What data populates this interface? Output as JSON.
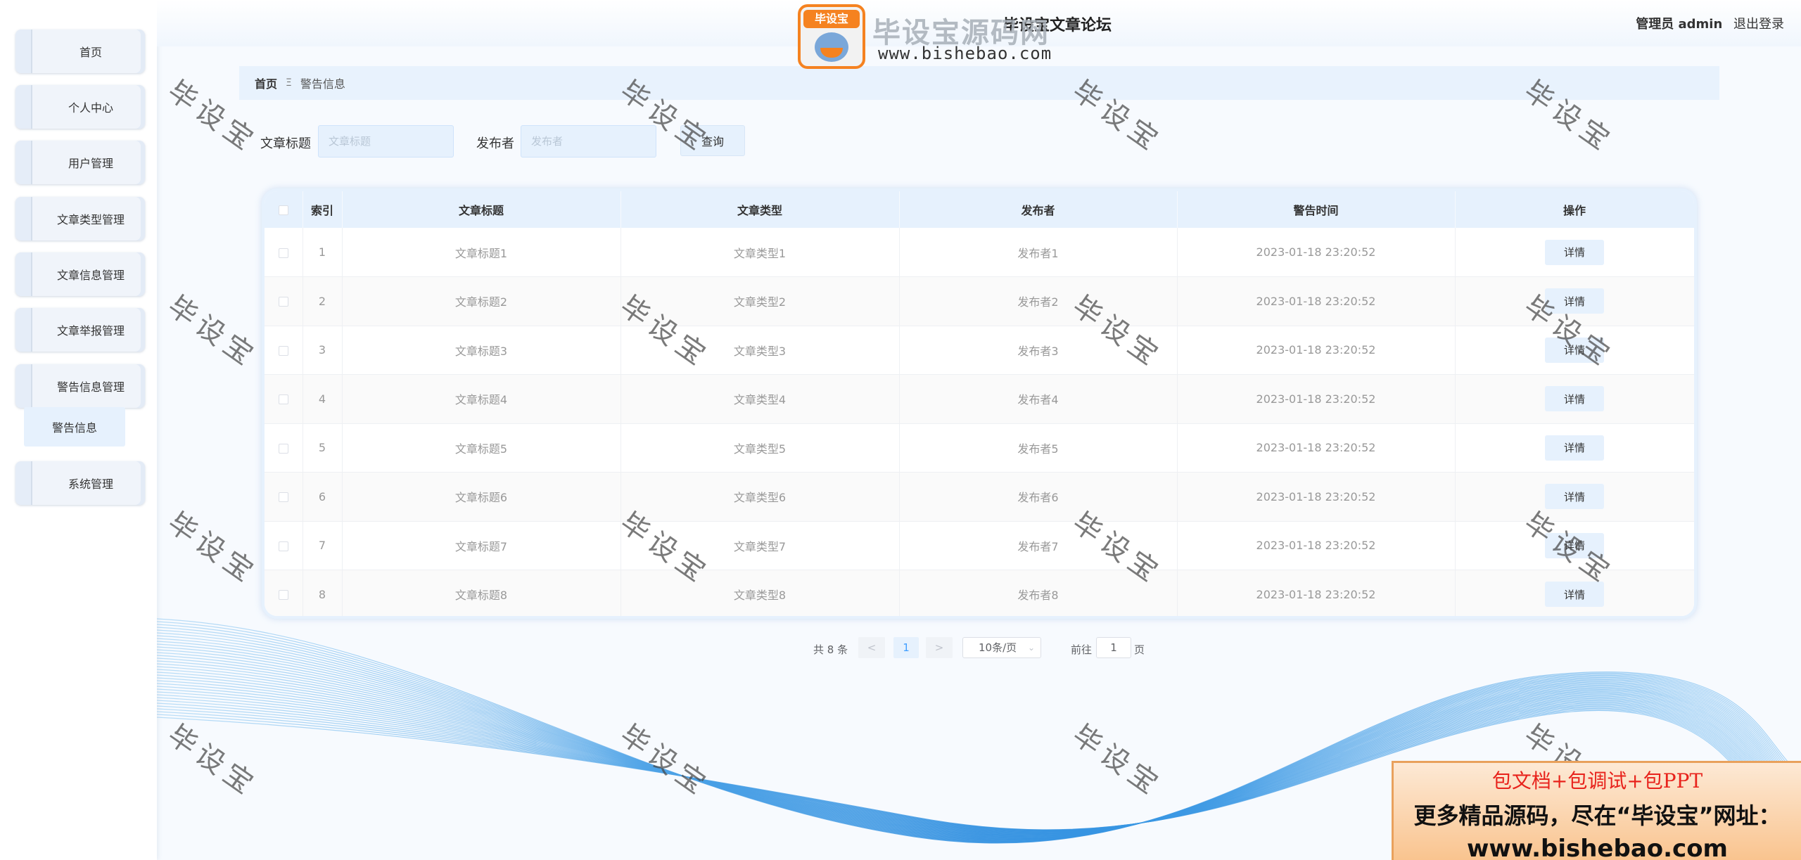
{
  "colors": {
    "accent": "#e6f1fd",
    "link": "#409eff",
    "wave": "#4aa3e8",
    "ad_red": "#e8231c"
  },
  "logo": {
    "badge": "毕设宝",
    "text": "毕设宝源码网",
    "url": "www.bishebao.com"
  },
  "header": {
    "title": "毕设宝文章论坛",
    "user_role": "管理员 admin",
    "logout": "退出登录"
  },
  "sidebar": {
    "items": [
      {
        "label": "首页"
      },
      {
        "label": "个人中心"
      },
      {
        "label": "用户管理"
      },
      {
        "label": "文章类型管理"
      },
      {
        "label": "文章信息管理"
      },
      {
        "label": "文章举报管理"
      },
      {
        "label": "警告信息管理"
      },
      {
        "label": "系统管理"
      }
    ],
    "submenu": {
      "label": "警告信息"
    }
  },
  "breadcrumb": {
    "home": "首页",
    "separator": "Ξ",
    "current": "警告信息"
  },
  "search": {
    "title_label": "文章标题",
    "title_placeholder": "文章标题",
    "author_label": "发布者",
    "author_placeholder": "发布者",
    "query_button": "查询"
  },
  "table": {
    "headers": {
      "index": "索引",
      "title": "文章标题",
      "type": "文章类型",
      "author": "发布者",
      "time": "警告时间",
      "action": "操作"
    },
    "detail_label": "详情",
    "rows": [
      {
        "index": "1",
        "title": "文章标题1",
        "type": "文章类型1",
        "author": "发布者1",
        "time": "2023-01-18 23:20:52"
      },
      {
        "index": "2",
        "title": "文章标题2",
        "type": "文章类型2",
        "author": "发布者2",
        "time": "2023-01-18 23:20:52"
      },
      {
        "index": "3",
        "title": "文章标题3",
        "type": "文章类型3",
        "author": "发布者3",
        "time": "2023-01-18 23:20:52"
      },
      {
        "index": "4",
        "title": "文章标题4",
        "type": "文章类型4",
        "author": "发布者4",
        "time": "2023-01-18 23:20:52"
      },
      {
        "index": "5",
        "title": "文章标题5",
        "type": "文章类型5",
        "author": "发布者5",
        "time": "2023-01-18 23:20:52"
      },
      {
        "index": "6",
        "title": "文章标题6",
        "type": "文章类型6",
        "author": "发布者6",
        "time": "2023-01-18 23:20:52"
      },
      {
        "index": "7",
        "title": "文章标题7",
        "type": "文章类型7",
        "author": "发布者7",
        "time": "2023-01-18 23:20:52"
      },
      {
        "index": "8",
        "title": "文章标题8",
        "type": "文章类型8",
        "author": "发布者8",
        "time": "2023-01-18 23:20:52"
      }
    ]
  },
  "pagination": {
    "total": "共 8 条",
    "prev": "<",
    "current": "1",
    "next": ">",
    "page_size": "10条/页",
    "goto_prefix": "前往",
    "goto_value": "1",
    "goto_suffix": "页"
  },
  "watermark": {
    "text": "毕设宝"
  },
  "ad": {
    "line1": "包文档+包调试+包PPT",
    "line2": "更多精品源码，尽在“毕设宝”网址：",
    "line3": "www.bishebao.com"
  }
}
